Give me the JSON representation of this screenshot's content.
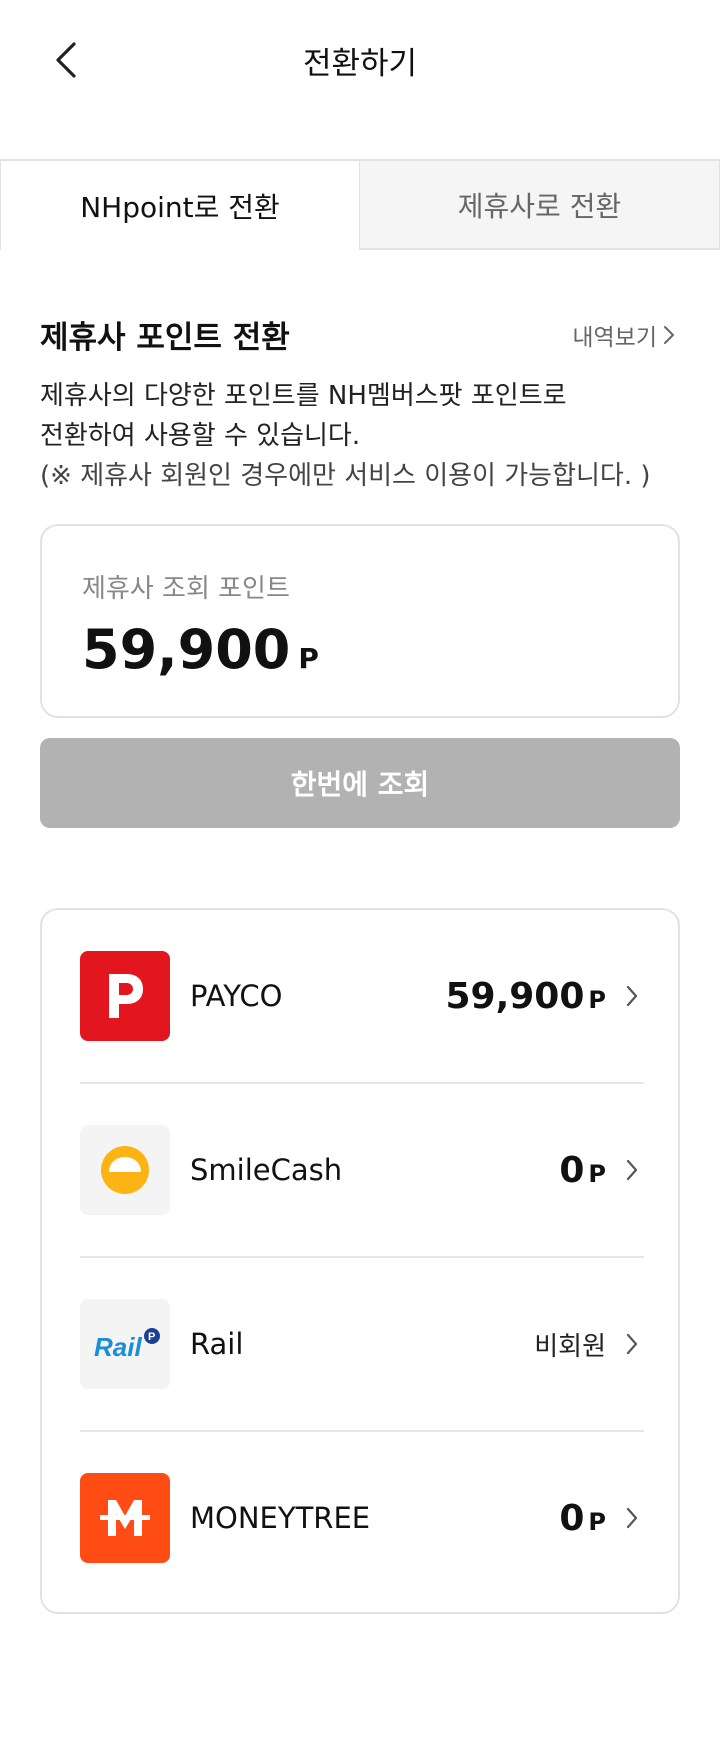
{
  "header": {
    "title": "전환하기",
    "back_icon": "chevron-left-icon"
  },
  "tabs": [
    {
      "label": "NHpoint로 전환",
      "active": true
    },
    {
      "label": "제휴사로 전환",
      "active": false
    }
  ],
  "section": {
    "title": "제휴사 포인트 전환",
    "history_link": "내역보기",
    "description_line1": "제휴사의 다양한 포인트를 NH멤버스팟 포인트로",
    "description_line2": "전환하여 사용할 수 있습니다.",
    "description_note": "(※ 제휴사 회원인 경우에만 서비스 이용이 가능합니다. )"
  },
  "point_summary": {
    "label": "제휴사 조회 포인트",
    "value": "59,900",
    "unit": "P"
  },
  "query_button": {
    "label": "한번에 조회"
  },
  "partners": [
    {
      "name": "PAYCO",
      "value": "59,900",
      "unit": "P",
      "logo": "payco-logo-icon",
      "color": "#e3151f"
    },
    {
      "name": "SmileCash",
      "value": "0",
      "unit": "P",
      "logo": "smilecash-logo-icon",
      "color": "#fbb414"
    },
    {
      "name": "Rail",
      "status": "비회원",
      "logo": "rail-logo-icon",
      "color": "#1a8fd8",
      "logo_text": "Rail"
    },
    {
      "name": "MONEYTREE",
      "value": "0",
      "unit": "P",
      "logo": "moneytree-logo-icon",
      "color": "#ff4b14"
    }
  ]
}
